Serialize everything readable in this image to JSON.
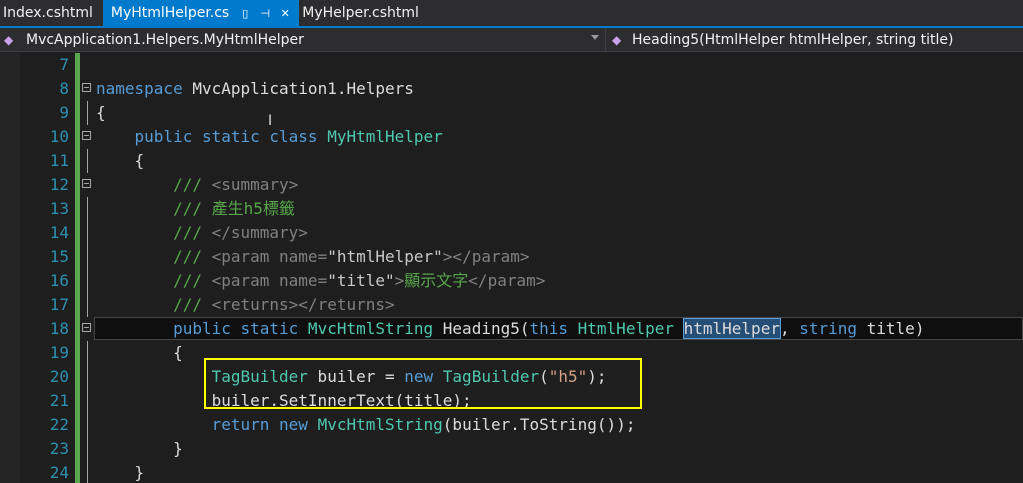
{
  "tabs": [
    {
      "label": "Index.cshtml",
      "active": false
    },
    {
      "label": "MyHtmlHelper.cs",
      "active": true
    },
    {
      "label": "MyHelper.cshtml",
      "active": false
    }
  ],
  "navbar": {
    "scope": "MvcApplication1.Helpers.MyHtmlHelper",
    "member": "Heading5(HtmlHelper htmlHelper, string title)"
  },
  "code": {
    "line_numbers": [
      "7",
      "8",
      "9",
      "10",
      "11",
      "12",
      "13",
      "14",
      "15",
      "16",
      "17",
      "18",
      "19",
      "20",
      "21",
      "22",
      "23",
      "24"
    ],
    "l8_kw": "namespace",
    "l8_name": " MvcApplication1.Helpers",
    "l9": "{",
    "l10_indent": "    ",
    "l10_kw": "public static class",
    "l10_name": " MyHtmlHelper",
    "l11": "    {",
    "l12_c": "        ///",
    "l12_x": " <summary>",
    "l13_c": "        ///",
    "l13_t": " 產生h5標籤",
    "l14_c": "        ///",
    "l14_x": " </summary>",
    "l15_c": "        ///",
    "l15_x1": " <param name=",
    "l15_s": "\"htmlHelper\"",
    "l15_x2": "></param>",
    "l16_c": "        ///",
    "l16_x1": " <param name=",
    "l16_s": "\"title\"",
    "l16_x2": ">",
    "l16_t": "顯示文字",
    "l16_x3": "</param>",
    "l17_c": "        ///",
    "l17_x": " <returns></returns>",
    "l18_indent": "        ",
    "l18_kw1": "public static",
    "l18_ty1": " MvcHtmlString",
    "l18_name": " Heading5(",
    "l18_kw2": "this",
    "l18_ty2": " HtmlHelper",
    "l18_sp": " ",
    "l18_hl": "htmlHelper",
    "l18_comma": ", ",
    "l18_kw3": "string",
    "l18_end": " title)",
    "l19": "        {",
    "l20_indent": "            ",
    "l20_ty1": "TagBuilder",
    "l20_mid": " builer = ",
    "l20_kw": "new",
    "l20_ty2": " TagBuilder",
    "l20_p1": "(",
    "l20_s": "\"h5\"",
    "l20_p2": ");",
    "l21": "            builer.SetInnerText(title);",
    "l22_indent": "            ",
    "l22_kw1": "return",
    "l22_sp": " ",
    "l22_kw2": "new",
    "l22_ty": " MvcHtmlString",
    "l22_end": "(builer.ToString());",
    "l23": "        }",
    "l24": "    }"
  }
}
